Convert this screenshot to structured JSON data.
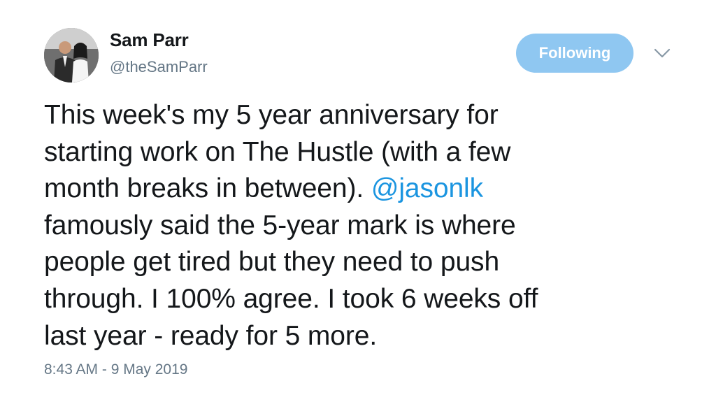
{
  "author": {
    "name": "Sam Parr",
    "handle": "@theSamParr"
  },
  "follow_button": {
    "label": "Following",
    "color": "#8fc7f1"
  },
  "menu": {
    "icon": "chevron-down-icon"
  },
  "tweet": {
    "lines": [
      "This week's my 5 year anniversary for",
      "starting work on The Hustle (with a few",
      "month breaks in between). ",
      "famously said the 5-year mark is where",
      "people get tired but they need to push",
      "through. I 100% agree. I took 6 weeks off",
      "last year - ready for 5 more."
    ],
    "mention": "@jasonlk",
    "mention_color": "#1b95e0"
  },
  "timestamp": "8:43 AM - 9 May 2019"
}
